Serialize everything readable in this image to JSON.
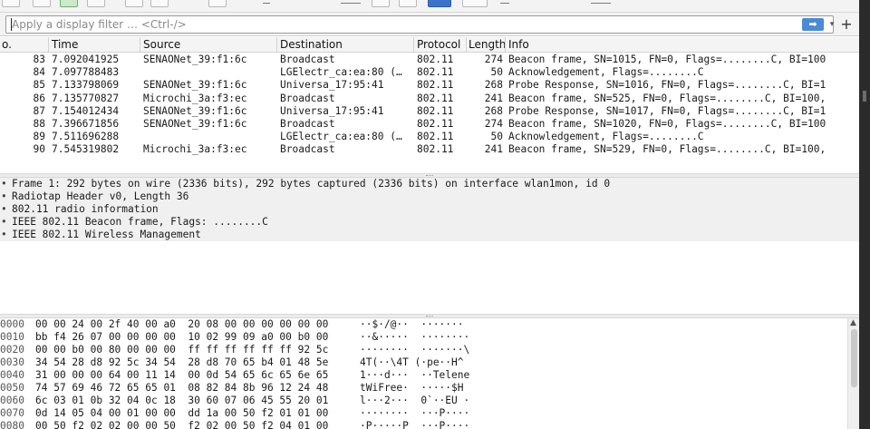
{
  "filter": {
    "placeholder": "Apply a display filter … <Ctrl-/>",
    "apply_icon": "arrow-right-icon",
    "dropdown_icon": "chevron-down-icon",
    "add_icon": "plus-icon",
    "add_symbol": "+",
    "apply_symbol": "➡",
    "dropdown_symbol": "▾",
    "accent_color": "#4a8ad6"
  },
  "packet_list": {
    "columns": [
      "o.",
      "Time",
      "Source",
      "Destination",
      "Protocol",
      "Length",
      "Info"
    ],
    "rows": [
      {
        "no": "83",
        "time": "7.092041925",
        "source": "SENAONet_39:f1:6c",
        "destination": "Broadcast",
        "protocol": "802.11",
        "length": "274",
        "info": "Beacon frame, SN=1015, FN=0, Flags=........C, BI=100"
      },
      {
        "no": "84",
        "time": "7.097788483",
        "source": "",
        "destination": "LGElectr_ca:ea:80 (…",
        "protocol": "802.11",
        "length": "50",
        "info": "Acknowledgement, Flags=........C"
      },
      {
        "no": "85",
        "time": "7.133798069",
        "source": "SENAONet_39:f1:6c",
        "destination": "Universa_17:95:41",
        "protocol": "802.11",
        "length": "268",
        "info": "Probe Response, SN=1016, FN=0, Flags=........C, BI=1"
      },
      {
        "no": "86",
        "time": "7.135770827",
        "source": "Microchi_3a:f3:ec",
        "destination": "Broadcast",
        "protocol": "802.11",
        "length": "241",
        "info": "Beacon frame, SN=525, FN=0, Flags=........C, BI=100,"
      },
      {
        "no": "87",
        "time": "7.154012434",
        "source": "SENAONet_39:f1:6c",
        "destination": "Universa_17:95:41",
        "protocol": "802.11",
        "length": "268",
        "info": "Probe Response, SN=1017, FN=0, Flags=........C, BI=1"
      },
      {
        "no": "88",
        "time": "7.396671856",
        "source": "SENAONet_39:f1:6c",
        "destination": "Broadcast",
        "protocol": "802.11",
        "length": "274",
        "info": "Beacon frame, SN=1020, FN=0, Flags=........C, BI=100"
      },
      {
        "no": "89",
        "time": "7.511696288",
        "source": "",
        "destination": "LGElectr_ca:ea:80 (…",
        "protocol": "802.11",
        "length": "50",
        "info": "Acknowledgement, Flags=........C"
      },
      {
        "no": "90",
        "time": "7.545319802",
        "source": "Microchi_3a:f3:ec",
        "destination": "Broadcast",
        "protocol": "802.11",
        "length": "241",
        "info": "Beacon frame, SN=529, FN=0, Flags=........C, BI=100,"
      }
    ]
  },
  "details": {
    "expander_symbol": "•",
    "items": [
      "Frame 1: 292 bytes on wire (2336 bits), 292 bytes captured (2336 bits) on interface wlan1mon, id 0",
      "Radiotap Header v0, Length 36",
      "802.11 radio information",
      "IEEE 802.11 Beacon frame, Flags: ........C",
      "IEEE 802.11 Wireless Management"
    ]
  },
  "bytes": {
    "rows": [
      {
        "offset": "0000",
        "hex": "00 00 24 00 2f 40 00 a0  20 08 00 00 00 00 00 00",
        "ascii": "··$·/@··  ·······"
      },
      {
        "offset": "0010",
        "hex": "bb f4 26 07 00 00 00 00  10 02 99 09 a0 00 b0 00",
        "ascii": "··&·····  ········"
      },
      {
        "offset": "0020",
        "hex": "00 00 b0 00 80 00 00 00  ff ff ff ff ff ff 92 5c",
        "ascii": "········  ·······\\"
      },
      {
        "offset": "0030",
        "hex": "34 54 28 d8 92 5c 34 54  28 d8 70 65 b4 01 48 5e",
        "ascii": "4T(··\\4T (·pe··H^"
      },
      {
        "offset": "0040",
        "hex": "31 00 00 00 64 00 11 14  00 0d 54 65 6c 65 6e 65",
        "ascii": "1···d···  ··Telene"
      },
      {
        "offset": "0050",
        "hex": "74 57 69 46 72 65 65 01  08 82 84 8b 96 12 24 48",
        "ascii": "tWiFree·  ·····$H"
      },
      {
        "offset": "0060",
        "hex": "6c 03 01 0b 32 04 0c 18  30 60 07 06 45 55 20 01",
        "ascii": "l···2···  0`··EU ·"
      },
      {
        "offset": "0070",
        "hex": "0d 14 05 04 00 01 00 00  dd 1a 00 50 f2 01 01 00",
        "ascii": "········  ···P····"
      },
      {
        "offset": "0080",
        "hex": "00 50 f2 02 02 00 00 50  f2 02 00 50 f2 04 01 00",
        "ascii": "·P·····P  ···P····"
      }
    ]
  }
}
